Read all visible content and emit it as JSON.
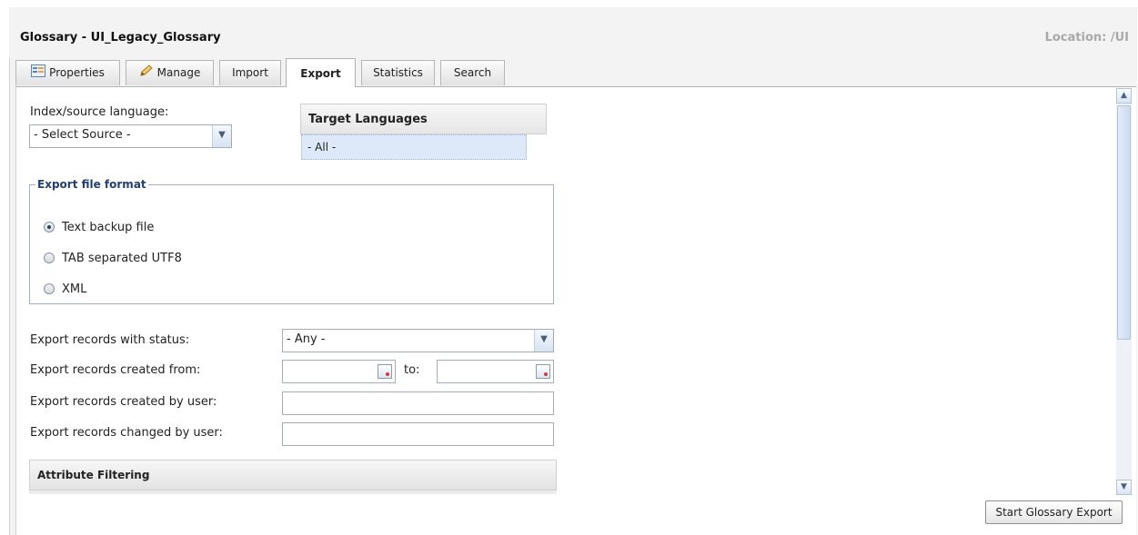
{
  "header": {
    "title": "Glossary - UI_Legacy_Glossary",
    "location": "Location: /UI"
  },
  "tabs": [
    {
      "label": "Properties",
      "icon": "properties-icon"
    },
    {
      "label": "Manage",
      "icon": "pencil-icon"
    },
    {
      "label": "Import"
    },
    {
      "label": "Export",
      "active": true
    },
    {
      "label": "Statistics"
    },
    {
      "label": "Search"
    }
  ],
  "source": {
    "label": "Index/source language:",
    "value": "- Select Source -"
  },
  "target_languages": {
    "header": "Target Languages",
    "items": [
      "- All -"
    ]
  },
  "export_format": {
    "legend": "Export file format",
    "options": [
      "Text backup file",
      "TAB separated UTF8",
      "XML"
    ],
    "selected": "Text backup file"
  },
  "filters": {
    "status_label": "Export records with status:",
    "status_value": "- Any -",
    "created_from_label": "Export records created from:",
    "to_label": "to:",
    "created_by_label": "Export records created by user:",
    "changed_by_label": "Export records changed by user:"
  },
  "attribute_filtering": {
    "header": "Attribute Filtering"
  },
  "actions": {
    "start_export": "Start Glossary Export"
  },
  "colors": {
    "legend_text": "#1f3e7a",
    "location_text": "#a9a9a9",
    "selected_row": "#dde8f8"
  }
}
